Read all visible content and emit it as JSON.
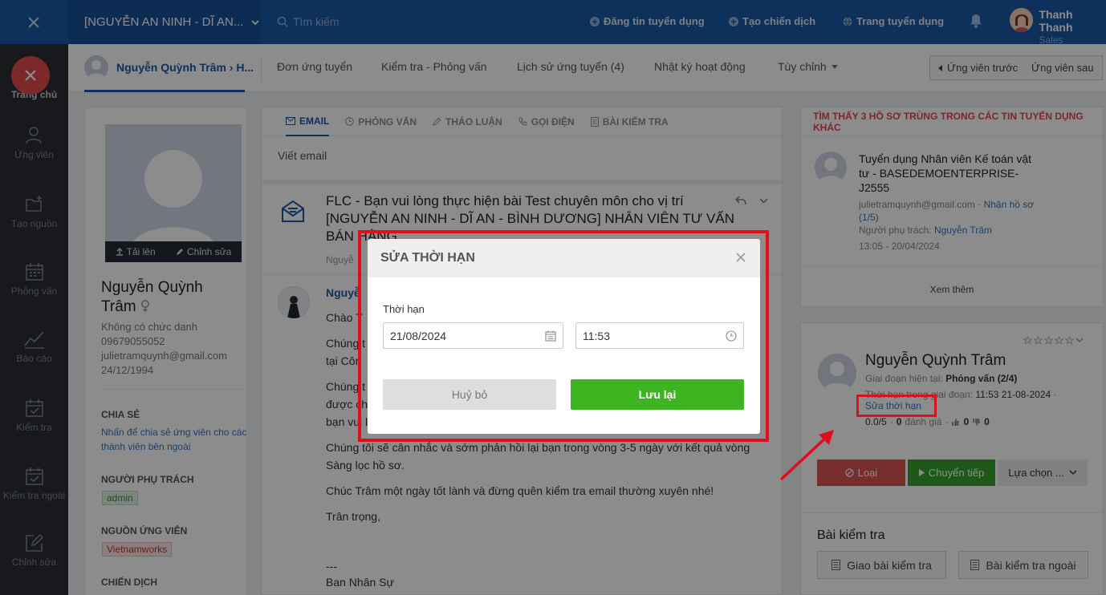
{
  "topbar": {
    "job_title": "[NGUYỄN AN NINH - DĨ AN...",
    "search_placeholder": "Tìm kiếm",
    "links": [
      "Đăng tin tuyển dụng",
      "Tạo chiến dịch",
      "Trang tuyển dụng"
    ],
    "user_name": "Thanh Thanh",
    "user_role": "Sales"
  },
  "sidebar": {
    "items": [
      "Trang chủ",
      "Ứng viên",
      "Tạo nguồn",
      "Phỏng vấn",
      "Báo cáo",
      "Kiểm tra",
      "Kiểm tra ngoài",
      "Chỉnh sửa"
    ]
  },
  "tabs": {
    "person": "Nguyễn Quỳnh Trâm › H...",
    "items": [
      "Đơn ứng tuyển",
      "Kiểm tra - Phỏng vấn",
      "Lịch sử ứng tuyển (4)",
      "Nhật ký hoạt động",
      "Tùy chỉnh"
    ],
    "prev": "Ứng viên trước",
    "next": "Ứng viên sau"
  },
  "profile": {
    "upload": "Tải lên",
    "edit": "Chỉnh sửa",
    "name": "Nguyễn Quỳnh Trâm",
    "title": "Không có chức danh",
    "phone": "09679055052",
    "email": "julietramquynh@gmail.com",
    "dob": "24/12/1994",
    "share_label": "CHIA SẺ",
    "share_link": "Nhấn để chia sẻ ứng viên cho các thành viên bên ngoài",
    "owner_label": "NGƯỜI PHỤ TRÁCH",
    "owner": "admin",
    "source_label": "NGUỒN ỨNG VIÊN",
    "source": "Vietnamworks",
    "campaign_label": "CHIẾN DỊCH"
  },
  "center": {
    "tabs": [
      "EMAIL",
      "PHỎNG VẤN",
      "THẢO LUẬN",
      "GỌI ĐIỆN",
      "BÀI KIỂM TRA"
    ],
    "compose": "Viết email",
    "subject": "FLC - Bạn vui lòng thực hiện bài Test chuyên môn cho vị trí [NGUYỄN AN NINH - DĨ AN - BÌNH DƯƠNG] NHÂN VIÊN TƯ VẤN BÁN HÀNG",
    "sender_short": "Nguyễ",
    "meta_short": "Nguyễ",
    "greet": "Chào T",
    "l1": "Chúng t",
    "l1b": "tại Côn",
    "l2": "Chúng t",
    "l2b": "được ch",
    "l2c": "bạn vui l",
    "l3": "Chúng tôi sẽ cân nhắc và sớm phản hồi lại bạn trong vòng 3-5 ngày với kết quả vòng Sàng lọc hồ sơ.",
    "l4": "Chúc Trâm một ngày tốt lành và đừng quên kiểm tra email thường xuyên nhé!",
    "l5": "Trân trọng,",
    "l6": "---",
    "l7": "Ban Nhân Sự"
  },
  "duplicate": {
    "banner": "TÌM THẤY 3 HỒ SƠ TRÙNG TRONG CÁC TIN TUYỂN DỤNG KHÁC",
    "job": "Tuyển dụng Nhân viên Kế toán vật tư - BASEDEMOENTERPRISE-J2555",
    "email": "julietramquynh@gmail.com",
    "stage": "Nhận hồ sơ (1/5)",
    "owner_label": "Người phụ trách:",
    "owner": "Nguyễn Trâm",
    "time": "13:05 - 20/04/2024",
    "more": "Xem thêm"
  },
  "candidate": {
    "name": "Nguyễn Quỳnh Trâm",
    "stage_label": "Giai đoạn hiện tại:",
    "stage": "Phỏng vấn (2/4)",
    "deadline_label": "Thời hạn trong giai đoạn:",
    "deadline": "11:53 21-08-2024",
    "edit_deadline": "Sửa thời hạn",
    "rating": "0.0/5",
    "votes": "0",
    "votes_label": "đánh giá",
    "likes": "0",
    "dislikes": "0",
    "reject": "Loại",
    "forward": "Chuyển tiếp",
    "choose": "Lựa chọn ...",
    "tests_title": "Bài kiểm tra",
    "assign_test": "Giao bài kiểm tra",
    "external_test": "Bài kiểm tra ngoài"
  },
  "modal": {
    "title": "SỬA THỜI HẠN",
    "label": "Thời hạn",
    "date": "21/08/2024",
    "time": "11:53",
    "cancel": "Huỷ bỏ",
    "save": "Lưu lại"
  },
  "colors": {
    "primary": "#1a5aa8",
    "save": "#3cb521",
    "reject": "#d9534f",
    "highlight": "#e0101a"
  }
}
